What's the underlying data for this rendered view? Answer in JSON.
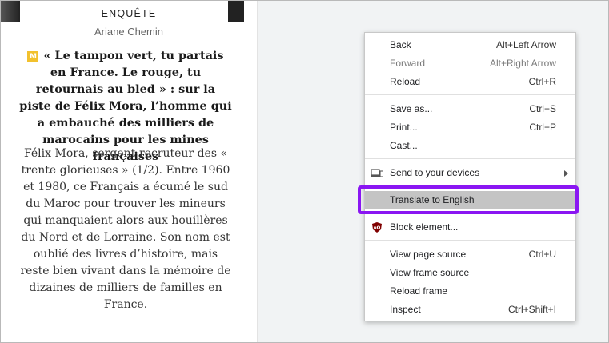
{
  "article": {
    "kicker": "ENQUÊTE",
    "author": "Ariane Chemin",
    "badge": "M",
    "headline": "« Le tampon vert, tu partais en France. Le rouge, tu retournais au bled » : sur la piste de Félix Mora, l’homme qui a embauché des milliers de marocains pour les mines françaises",
    "body": "Félix Mora, sergent-recruteur des « trente glorieuses » (1/2). Entre 1960 et 1980, ce Français a écumé le sud du Maroc pour trouver les mineurs qui manquaient alors aux houillères du Nord et de Lorraine. Son nom est oublié des livres d’histoire, mais reste bien vivant dans la mémoire de dizaines de milliers de familles en France."
  },
  "context_menu": {
    "items": [
      {
        "label": "Back",
        "shortcut": "Alt+Left Arrow",
        "disabled": false
      },
      {
        "label": "Forward",
        "shortcut": "Alt+Right Arrow",
        "disabled": true
      },
      {
        "label": "Reload",
        "shortcut": "Ctrl+R",
        "disabled": false
      },
      {
        "label": "Save as...",
        "shortcut": "Ctrl+S",
        "disabled": false
      },
      {
        "label": "Print...",
        "shortcut": "Ctrl+P",
        "disabled": false
      },
      {
        "label": "Cast...",
        "shortcut": "",
        "disabled": false
      },
      {
        "label": "Send to your devices",
        "icon": "laptop-phone-icon",
        "submenu": true
      },
      {
        "label": "Translate to English",
        "highlighted": true
      },
      {
        "label": "Block element...",
        "icon": "ublock-origin-icon"
      },
      {
        "label": "View page source",
        "shortcut": "Ctrl+U"
      },
      {
        "label": "View frame source",
        "shortcut": ""
      },
      {
        "label": "Reload frame",
        "shortcut": ""
      },
      {
        "label": "Inspect",
        "shortcut": "Ctrl+Shift+I"
      }
    ]
  },
  "colors": {
    "highlight_outline": "#8a16f2",
    "badge": "#f2c12e",
    "ublock": "#800000"
  }
}
